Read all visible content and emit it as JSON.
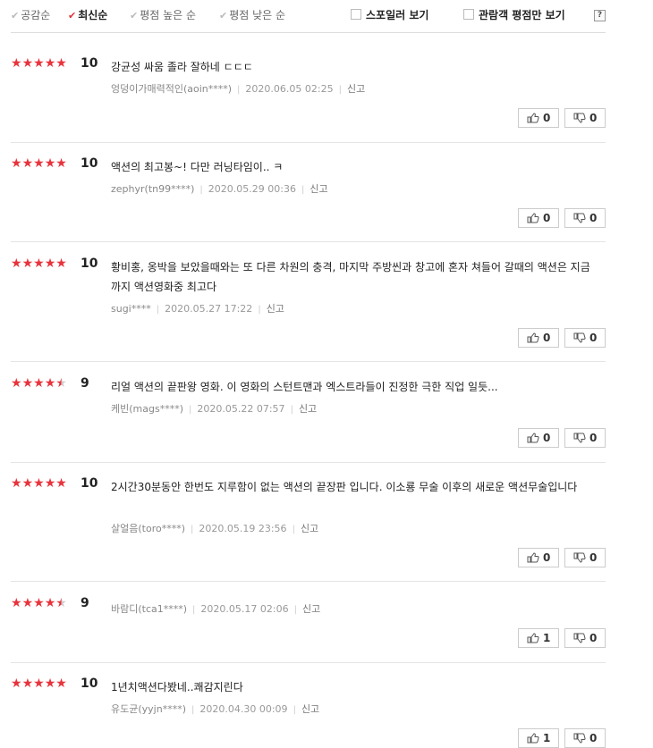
{
  "sort": {
    "options": [
      {
        "label": "공감순",
        "active": false
      },
      {
        "label": "최신순",
        "active": true
      },
      {
        "label": "평점 높은 순",
        "active": false
      },
      {
        "label": "평점 낮은 순",
        "active": false
      }
    ],
    "check_glyph": "✔"
  },
  "filters": {
    "spoiler": "스포일러 보기",
    "viewer_only": "관람객 평점만 보기",
    "help": "?"
  },
  "reviews": [
    {
      "rating": 10,
      "score": "10",
      "text": "강균성 싸움 졸라 잘하네 ㄷㄷㄷ",
      "author": "엉덩이가매력적인(aoin****)",
      "date": "2020.06.05 02:25",
      "report": "신고",
      "up": "0",
      "down": "0"
    },
    {
      "rating": 10,
      "score": "10",
      "text": "액션의 최고봉~! 다만 러닝타임이.. ㅋ",
      "author": "zephyr(tn99****)",
      "date": "2020.05.29 00:36",
      "report": "신고",
      "up": "0",
      "down": "0"
    },
    {
      "rating": 10,
      "score": "10",
      "text": "황비홍, 옹박을 보았을때와는 또 다른 차원의 충격, 마지막 주방씬과 창고에 혼자 쳐들어 갈때의 액션은 지금까지 액션영화중 최고다",
      "author": "sugi****",
      "date": "2020.05.27 17:22",
      "report": "신고",
      "up": "0",
      "down": "0"
    },
    {
      "rating": 9,
      "score": "9",
      "text": "리얼 액션의 끝판왕 영화. 이 영화의 스턴트맨과 엑스트라들이 진정한 극한 직업 일듯...",
      "author": "케빈(mags****)",
      "date": "2020.05.22 07:57",
      "report": "신고",
      "up": "0",
      "down": "0"
    },
    {
      "rating": 10,
      "score": "10",
      "text": "2시간30분동안 한번도 지루함이 없는 액션의 끝장판 입니다. 이소룡 무술 이후의 새로운 액션무술입니다",
      "author": "살얼음(toro****)",
      "date": "2020.05.19 23:56",
      "report": "신고",
      "up": "0",
      "down": "0"
    },
    {
      "rating": 9,
      "score": "9",
      "text": "",
      "author": "바람디(tca1****)",
      "date": "2020.05.17 02:06",
      "report": "신고",
      "up": "1",
      "down": "0"
    },
    {
      "rating": 10,
      "score": "10",
      "text": "1년치액션다봤네..쾌감지린다",
      "author": "유도균(yyjn****)",
      "date": "2020.04.30 00:09",
      "report": "신고",
      "up": "1",
      "down": "0"
    }
  ],
  "colors": {
    "star": "#e8333c",
    "check_active": "#e0323a"
  },
  "icons": {
    "up": "thumbs-up-icon",
    "down": "thumbs-down-icon",
    "star": "star-icon"
  }
}
